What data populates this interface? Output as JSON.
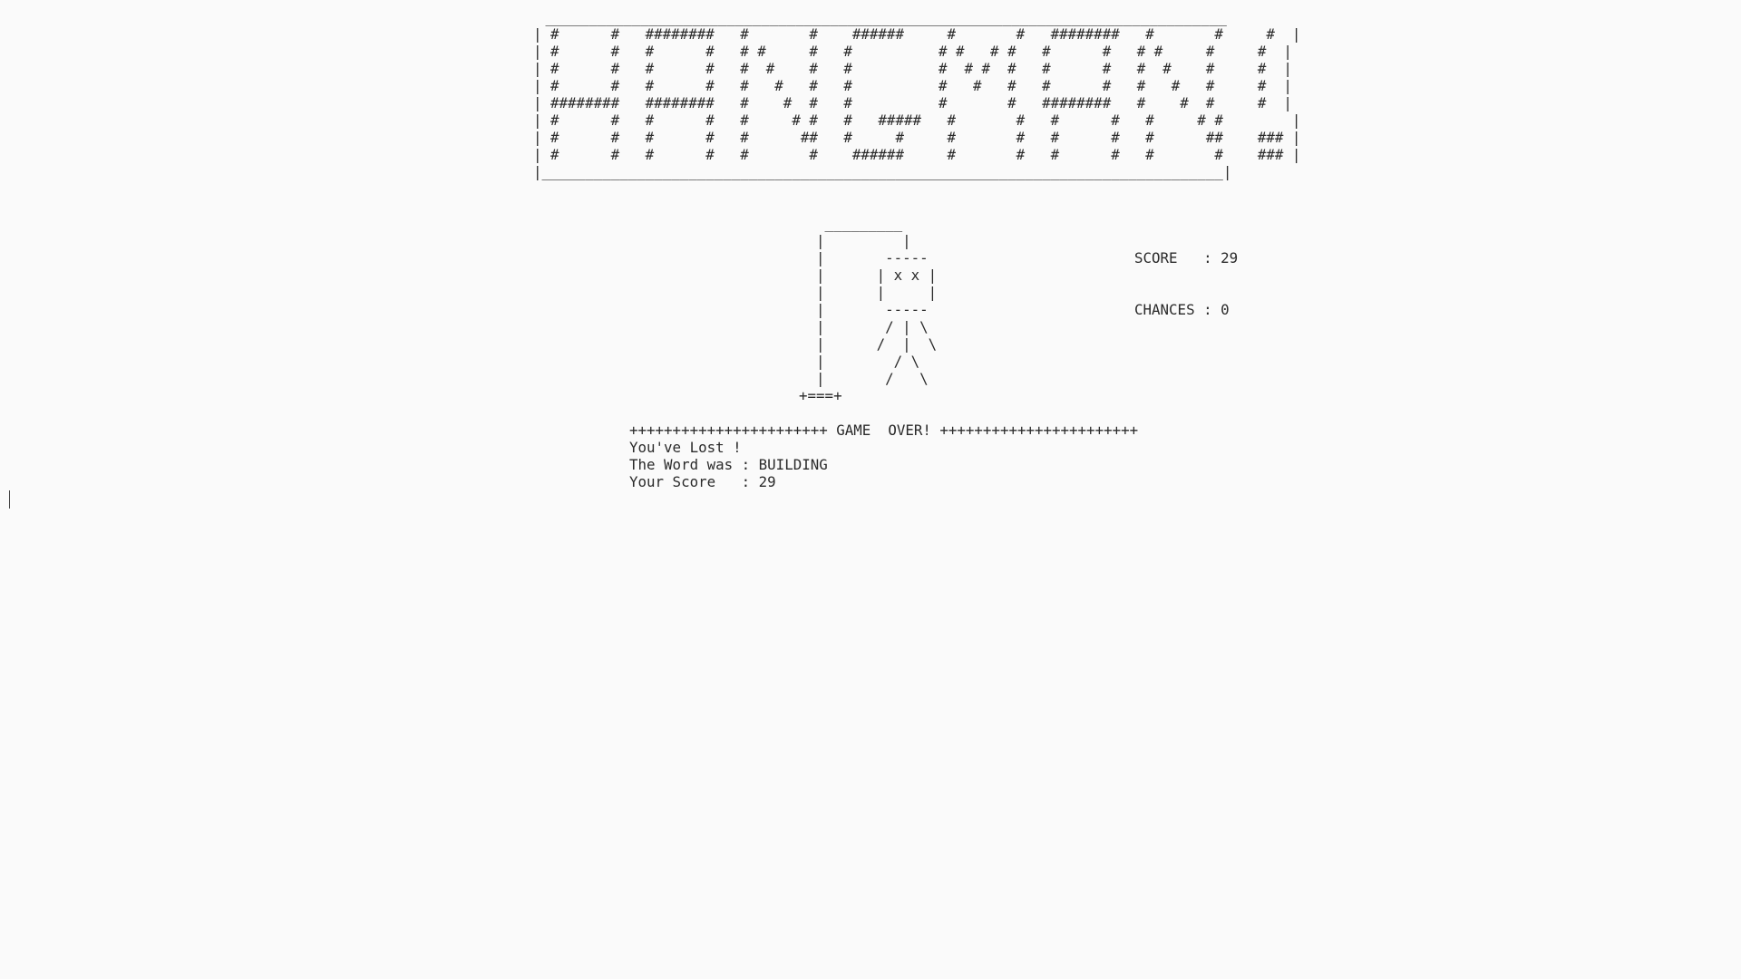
{
  "banner": {
    "top": " _______________________________________________________________________________",
    "rows": [
      "| #      #   ########   #       #    ######     #       #   ########   #       #     #  |",
      "| #      #   #      #   # #     #   #          # #   # #   #      #   # #     #     #  |",
      "| #      #   #      #   #  #    #   #          #  # #  #   #      #   #  #    #     #  |",
      "| #      #   #      #   #   #   #   #          #   #   #   #      #   #   #   #     #  |",
      "| ########   ########   #    #  #   #          #       #   ########   #    #  #     #  |",
      "| #      #   #      #   #     # #   #   #####   #       #   #      #   #     # #        |",
      "| #      #   #      #   #      ##   #     #     #       #   #      #   #      ##    ### |",
      "| #      #   #      #   #       #    ######     #       #   #      #   #       #    ### |"
    ],
    "bottom": "|_______________________________________________________________________________|"
  },
  "gallows": {
    "lines": [
      "     _________",
      "    |         |",
      "    |       -----",
      "    |      | x x |",
      "    |      |     |",
      "    |       -----",
      "    |       / | \\",
      "    |      /  |  \\",
      "    |        / \\",
      "    |       /   \\",
      "  +===+"
    ]
  },
  "stats": {
    "score_text": "SCORE   : 29",
    "chances_text": "CHANCES : 0"
  },
  "result": {
    "header": "+++++++++++++++++++++++ GAME  OVER! +++++++++++++++++++++++",
    "lost": "You've Lost !",
    "word": "The Word was : BUILDING",
    "score": "Your Score   : 29"
  }
}
